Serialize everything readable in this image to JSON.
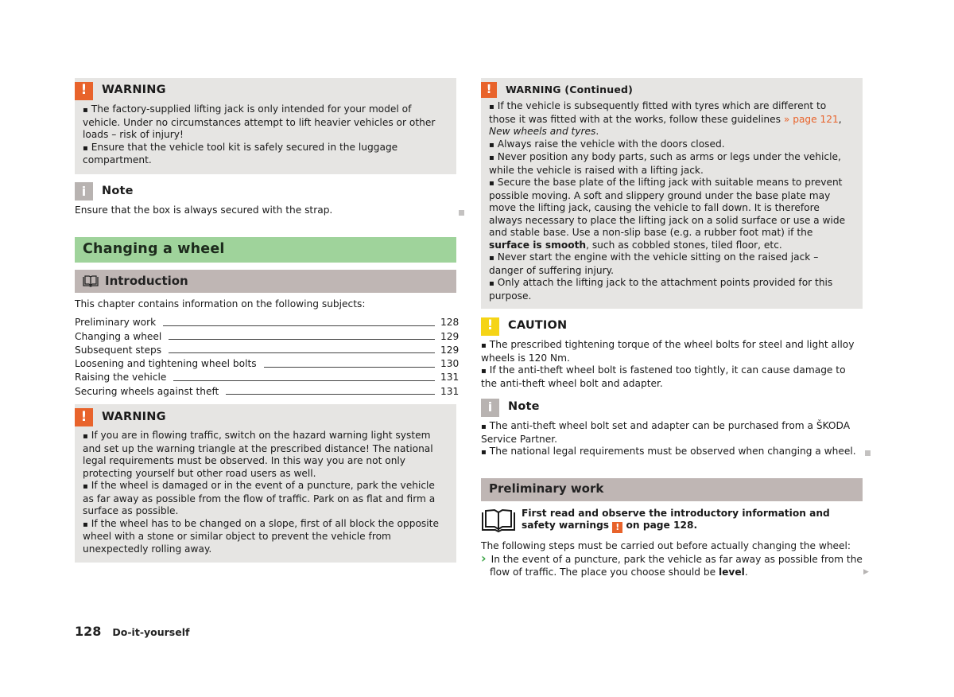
{
  "left": {
    "warning1": {
      "title": "WARNING",
      "icon": "exclamation-icon",
      "items": [
        "The factory-supplied lifting jack is only intended for your model of vehicle. Under no circumstances attempt to lift heavier vehicles or other loads – risk of injury!",
        "Ensure that the vehicle tool kit is safely secured in the luggage compartment."
      ]
    },
    "note1": {
      "title": "Note",
      "icon": "info-icon",
      "text": "Ensure that the box is always secured with the strap."
    },
    "section_title": "Changing a wheel",
    "intro": {
      "title": "Introduction",
      "icon": "book-icon",
      "lead": "This chapter contains information on the following subjects:",
      "toc": [
        {
          "label": "Preliminary work",
          "page": "128"
        },
        {
          "label": "Changing a wheel",
          "page": "129"
        },
        {
          "label": "Subsequent steps",
          "page": "129"
        },
        {
          "label": "Loosening and tightening wheel bolts",
          "page": "130"
        },
        {
          "label": "Raising the vehicle",
          "page": "131"
        },
        {
          "label": "Securing wheels against theft",
          "page": "131"
        }
      ]
    },
    "warning2": {
      "title": "WARNING",
      "icon": "exclamation-icon",
      "items": [
        "If you are in flowing traffic, switch on the hazard warning light system and set up the warning triangle at the prescribed distance! The national legal requirements must be observed. In this way you are not only protecting yourself but other road users as well.",
        "If the wheel is damaged or in the event of a puncture, park the vehicle as far away as possible from the flow of traffic. Park on as flat and firm a surface as possible.",
        "If the wheel has to be changed on a slope, first of all block the opposite wheel with a stone or similar object to prevent the vehicle from unexpectedly rolling away."
      ]
    }
  },
  "right": {
    "warning_cont": {
      "title": "WARNING (Continued)",
      "icon": "exclamation-icon",
      "item1_pre": "If the vehicle is subsequently fitted with tyres which are different to those it was fitted with at the works, follow these guidelines ",
      "item1_link": "» page 121",
      "item1_sep": ", ",
      "item1_italic": "New wheels and tyres",
      "item1_post": ".",
      "item2": "Always raise the vehicle with the doors closed.",
      "item3": "Never position any body parts, such as arms or legs under the vehicle, while the vehicle is raised with a lifting jack.",
      "item4_pre": "Secure the base plate of the lifting jack with suitable means to prevent possible moving. A soft and slippery ground under the base plate may move the lifting jack, causing the vehicle to fall down. It is therefore always necessary to place the lifting jack on a solid surface or use a wide and stable base. Use a non-slip base (e.g. a rubber foot mat) if the ",
      "item4_bold": "surface is smooth",
      "item4_post": ", such as cobbled stones, tiled floor, etc.",
      "item5": "Never start the engine with the vehicle sitting on the raised jack – danger of suffering injury.",
      "item6": "Only attach the lifting jack to the attachment points provided for this purpose."
    },
    "caution": {
      "title": "CAUTION",
      "icon": "exclamation-icon",
      "items": [
        "The prescribed tightening torque of the wheel bolts for steel and light alloy wheels is 120 Nm.",
        "If the anti-theft wheel bolt is fastened too tightly, it can cause damage to the anti-theft wheel bolt and adapter."
      ]
    },
    "note2": {
      "title": "Note",
      "icon": "info-icon",
      "items": [
        "The anti-theft wheel bolt set and adapter can be purchased from a ŠKODA Service Partner.",
        "The national legal requirements must be observed when changing a wheel."
      ]
    },
    "prelim": {
      "title": "Preliminary work",
      "ref_pre": "First read and observe the introductory information and safety warnings ",
      "ref_post": " on page 128.",
      "lead": "The following steps must be carried out before actually changing the wheel:",
      "step_pre": "In the event of a puncture, park the vehicle as far away as possible from the flow of traffic. The place you choose should be ",
      "step_bold": "level",
      "step_post": "."
    }
  },
  "footer": {
    "page_number": "128",
    "chapter": "Do-it-yourself"
  },
  "colors": {
    "warning": "#e8632b",
    "caution": "#f5d416",
    "note": "#b8b3b1",
    "section_green": "#9fd39b",
    "subsection_grey": "#bfb6b4",
    "box_bg": "#e6e5e3"
  }
}
